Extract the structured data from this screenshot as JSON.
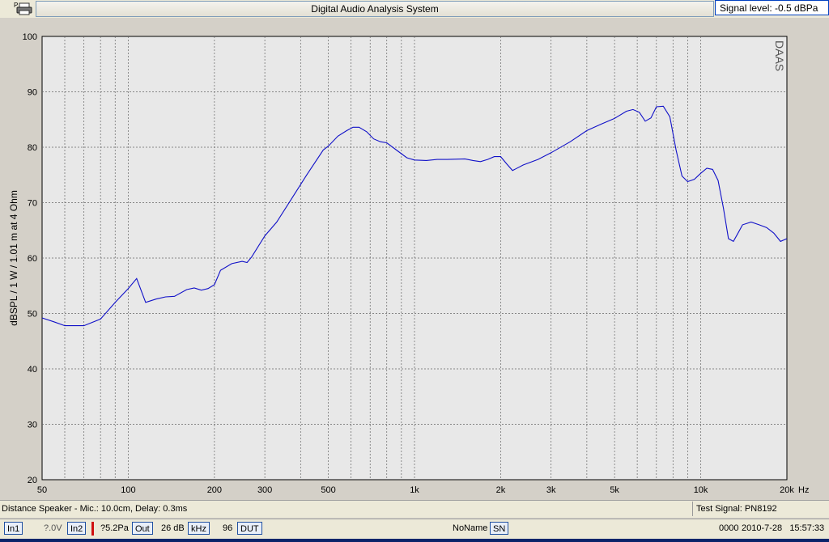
{
  "window": {
    "title": "Digital Audio Analysis System",
    "signal_level": "Signal level: -0.5 dBPa",
    "print_icon": "printer-icon"
  },
  "chart_data": {
    "type": "line",
    "title": "",
    "watermark": "DAAS",
    "ylabel": "dBSPL / 1 W / 1.01 m at 4 Ohm",
    "xlabel": "Hz",
    "xscale": "log",
    "xlim": [
      50,
      20000
    ],
    "ylim": [
      20,
      100
    ],
    "grid": true,
    "x_tick_labels": [
      "50",
      "100",
      "200",
      "300",
      "500",
      "1k",
      "2k",
      "3k",
      "5k",
      "10k",
      "20k"
    ],
    "x_tick_values": [
      50,
      100,
      200,
      300,
      500,
      1000,
      2000,
      3000,
      5000,
      10000,
      20000
    ],
    "y_ticks": [
      20,
      30,
      40,
      50,
      60,
      70,
      80,
      90,
      100
    ],
    "line_color": "#1010c8",
    "background": "#e8e8e8",
    "series": [
      {
        "x": [
          50,
          55,
          60,
          65,
          70,
          80,
          90,
          100,
          107,
          115,
          125,
          135,
          145,
          160,
          170,
          180,
          190,
          200,
          210,
          230,
          250,
          260,
          270,
          300,
          330,
          370,
          420,
          480,
          500,
          540,
          580,
          610,
          640,
          680,
          720,
          760,
          800,
          880,
          940,
          1000,
          1100,
          1200,
          1300,
          1500,
          1600,
          1700,
          1800,
          1900,
          2000,
          2100,
          2200,
          2400,
          2700,
          3000,
          3500,
          4000,
          4500,
          5000,
          5500,
          5800,
          6100,
          6400,
          6700,
          7000,
          7400,
          7800,
          8200,
          8600,
          9000,
          9500,
          10000,
          10500,
          11000,
          11500,
          12000,
          12500,
          13000,
          13500,
          14000,
          15000,
          16000,
          17000,
          18000,
          19000,
          20000
        ],
        "y": [
          49.2,
          48.5,
          47.8,
          47.8,
          47.8,
          49.0,
          52.0,
          54.5,
          56.3,
          52.0,
          52.6,
          53.0,
          53.1,
          54.3,
          54.6,
          54.2,
          54.5,
          55.2,
          57.8,
          59.0,
          59.4,
          59.2,
          60.2,
          64.0,
          66.5,
          70.5,
          75.0,
          79.5,
          80.2,
          82.0,
          83.0,
          83.6,
          83.6,
          82.8,
          81.5,
          81.0,
          80.8,
          79.2,
          78.1,
          77.7,
          77.6,
          77.8,
          77.8,
          77.9,
          77.6,
          77.4,
          77.8,
          78.3,
          78.3,
          77.0,
          75.8,
          76.8,
          77.8,
          79.0,
          81.0,
          83.0,
          84.2,
          85.2,
          86.5,
          86.8,
          86.3,
          84.7,
          85.3,
          87.3,
          87.4,
          85.5,
          79.5,
          74.8,
          73.8,
          74.2,
          75.3,
          76.2,
          76.0,
          74.0,
          69.0,
          63.5,
          63.0,
          64.5,
          66.0,
          66.5,
          66.0,
          65.5,
          64.5,
          63.0,
          63.5
        ]
      }
    ]
  },
  "status_bar_1": {
    "measurement_info": "Distance Speaker - Mic.: 10.0cm, Delay: 0.3ms",
    "test_signal": "Test Signal: PN8192"
  },
  "status_bar_2": {
    "in1": "In1",
    "in1_value": "?.0V",
    "in2": "In2",
    "in2_value": "?5.2Pa",
    "out": "Out",
    "out_value": "26 dB",
    "khz": "kHz",
    "khz_value": "96",
    "dut": "DUT",
    "noname": "NoName",
    "sn": "SN",
    "counter": "0000",
    "datetime": "2010-7-28   15:57:33"
  }
}
